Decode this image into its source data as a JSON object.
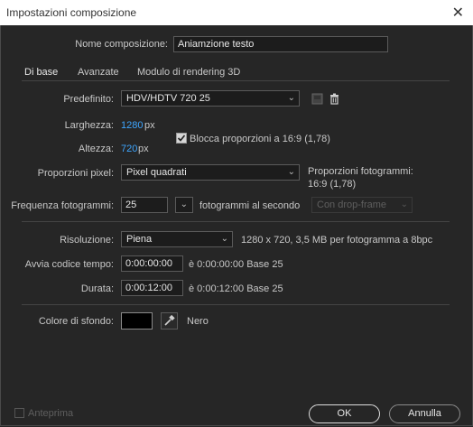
{
  "window": {
    "title": "Impostazioni composizione"
  },
  "name": {
    "label": "Nome composizione:",
    "value": "Aniamzione testo"
  },
  "tabs": [
    {
      "label": "Di base"
    },
    {
      "label": "Avanzate"
    },
    {
      "label": "Modulo di rendering 3D"
    }
  ],
  "preset": {
    "label": "Predefinito:",
    "value": "HDV/HDTV 720 25"
  },
  "width": {
    "label": "Larghezza:",
    "value": "1280",
    "unit": "px"
  },
  "height": {
    "label": "Altezza:",
    "value": "720",
    "unit": "px"
  },
  "lock": {
    "label": "Blocca proporzioni a 16:9 (1,78)",
    "checked": true
  },
  "pixel_aspect": {
    "label": "Proporzioni pixel:",
    "value": "Pixel quadrati"
  },
  "frame_aspect": {
    "label": "Proporzioni fotogrammi:",
    "value": "16:9 (1,78)"
  },
  "frame_rate": {
    "label": "Frequenza fotogrammi:",
    "value": "25",
    "unit": "fotogrammi al secondo",
    "drop_frame": "Con drop-frame"
  },
  "resolution": {
    "label": "Risoluzione:",
    "value": "Piena",
    "info": "1280 x 720, 3,5 MB per fotogramma a 8bpc"
  },
  "start_timecode": {
    "label": "Avvia codice tempo:",
    "value": "0:00:00:00",
    "info": "è 0:00:00:00  Base 25"
  },
  "duration": {
    "label": "Durata:",
    "value": "0:00:12:00",
    "info": "è 0:00:12:00  Base 25"
  },
  "background": {
    "label": "Colore di sfondo:",
    "color": "#000000",
    "name": "Nero"
  },
  "footer": {
    "preview": "Anteprima",
    "ok": "OK",
    "cancel": "Annulla"
  },
  "colors": {
    "accent": "#3ea6ff",
    "bg": "#262626",
    "field_bg": "#1c1c1c"
  }
}
